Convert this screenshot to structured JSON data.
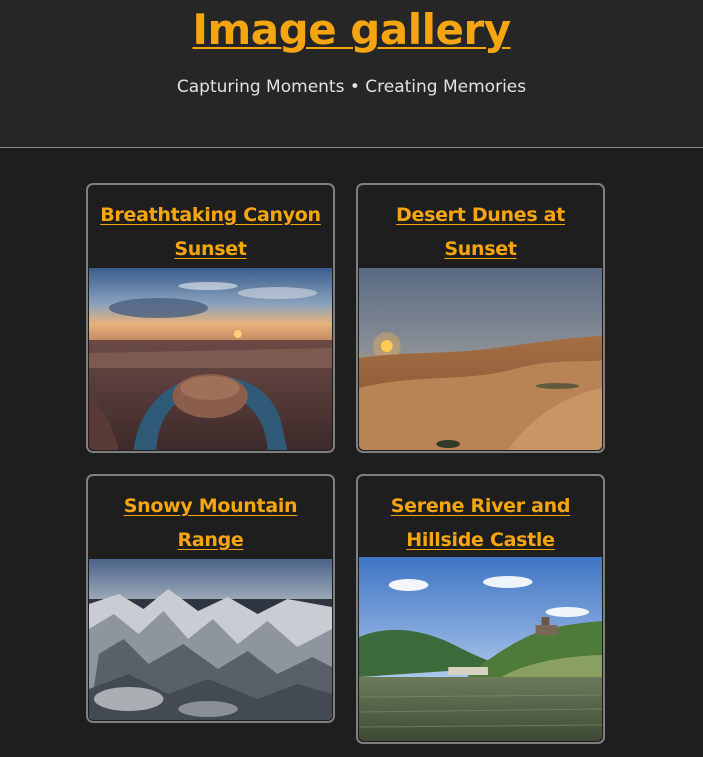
{
  "header": {
    "title": "Image gallery",
    "subtitle": "Capturing Moments • Creating Memories"
  },
  "gallery": [
    {
      "title": "Breathtaking Canyon Sunset",
      "image": "canyon-sunset-photo"
    },
    {
      "title": "Desert Dunes at Sunset",
      "image": "desert-dunes-photo"
    },
    {
      "title": "Snowy Mountain Range",
      "image": "snowy-mountains-photo"
    },
    {
      "title": "Serene River and Hillside Castle",
      "image": "river-castle-photo"
    }
  ],
  "colors": {
    "accent": "#f5a510",
    "background": "#1e1e1e",
    "header_bg": "#262626",
    "card_border": "#7f7f7f"
  }
}
